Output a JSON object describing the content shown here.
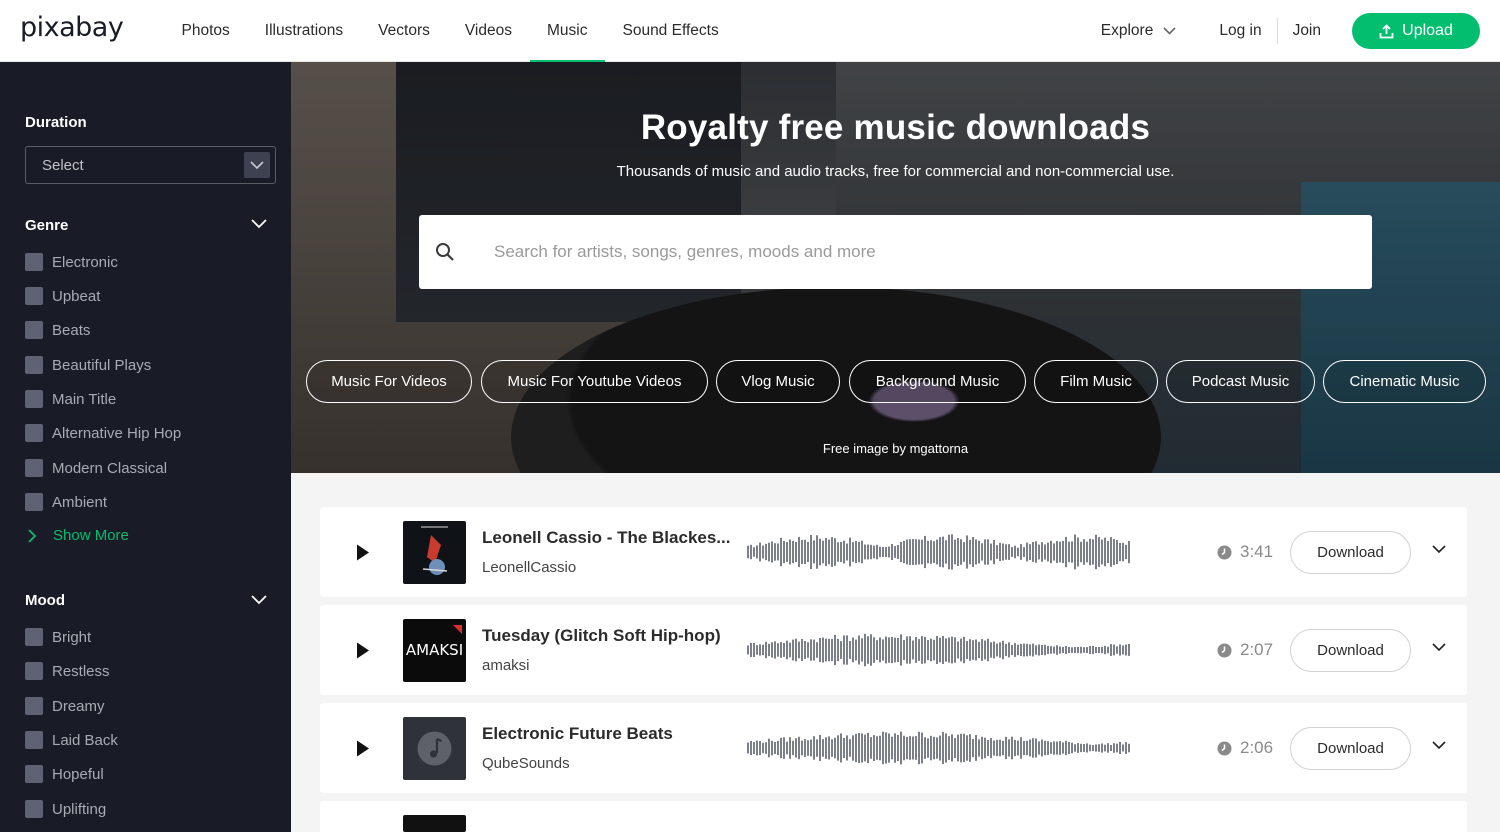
{
  "header": {
    "logo": "pixabay",
    "nav": [
      "Photos",
      "Illustrations",
      "Vectors",
      "Videos",
      "Music",
      "Sound Effects"
    ],
    "active_nav": "Music",
    "explore": "Explore",
    "login": "Log in",
    "join": "Join",
    "upload": "Upload"
  },
  "sidebar": {
    "duration": {
      "title": "Duration",
      "select_value": "Select"
    },
    "genre": {
      "title": "Genre",
      "items": [
        "Electronic",
        "Upbeat",
        "Beats",
        "Beautiful Plays",
        "Main Title",
        "Alternative Hip Hop",
        "Modern Classical",
        "Ambient"
      ],
      "show_more": "Show More"
    },
    "mood": {
      "title": "Mood",
      "items": [
        "Bright",
        "Restless",
        "Dreamy",
        "Laid Back",
        "Hopeful",
        "Uplifting"
      ]
    }
  },
  "hero": {
    "title": "Royalty free music downloads",
    "subtitle": "Thousands of music and audio tracks, free for commercial and non-commercial use.",
    "search_placeholder": "Search for artists, songs, genres, moods and more",
    "chips": [
      "Music For Videos",
      "Music For Youtube Videos",
      "Vlog Music",
      "Background Music",
      "Film Music",
      "Podcast Music",
      "Cinematic Music"
    ],
    "credit": "Free image by mgattorna"
  },
  "tracks": [
    {
      "title": "Leonell Cassio - The Blackes...",
      "artist": "LeonellCassio",
      "duration": "3:41",
      "download": "Download",
      "cover_text": ""
    },
    {
      "title": "Tuesday (Glitch Soft Hip-hop)",
      "artist": "amaksi",
      "duration": "2:07",
      "download": "Download",
      "cover_text": "AMAKSI"
    },
    {
      "title": "Electronic Future Beats",
      "artist": "QubeSounds",
      "duration": "2:06",
      "download": "Download",
      "cover_text": ""
    }
  ],
  "colors": {
    "brand_green": "#02be6e",
    "sidebar_bg": "#191b26",
    "waveform": "#7b8088"
  }
}
